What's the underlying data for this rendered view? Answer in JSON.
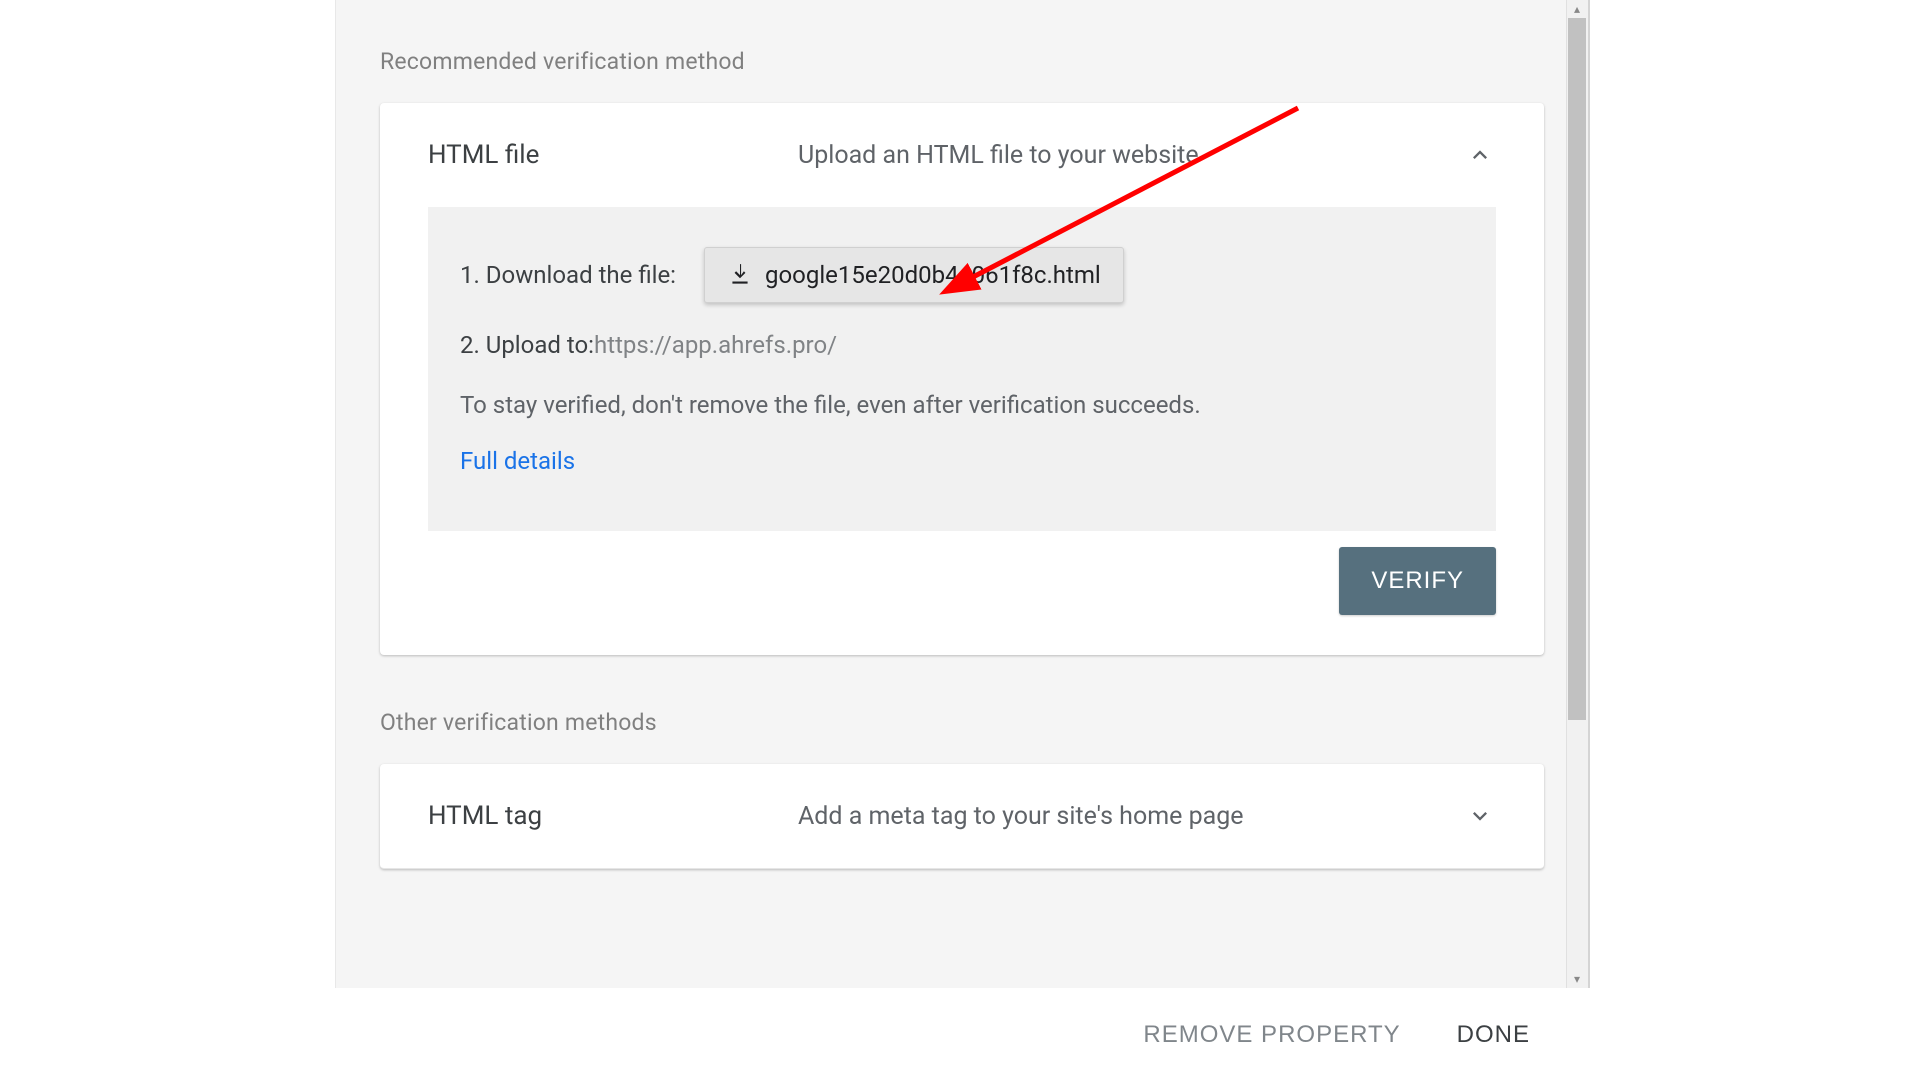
{
  "sections": {
    "recommended_label": "Recommended verification method",
    "other_label": "Other verification methods"
  },
  "htmlFileCard": {
    "title": "HTML file",
    "subtitle": "Upload an HTML file to your website",
    "step1_label": "1. Download the file:",
    "download_filename": "google15e20d0b4a061f8c.html",
    "step2_label": "2. Upload to: ",
    "upload_url": "https://app.ahrefs.pro/",
    "note": "To stay verified, don't remove the file, even after verification succeeds.",
    "details_link": "Full details",
    "verify_button": "VERIFY"
  },
  "htmlTagCard": {
    "title": "HTML tag",
    "subtitle": "Add a meta tag to your site's home page"
  },
  "footer": {
    "remove": "REMOVE PROPERTY",
    "done": "DONE"
  },
  "colors": {
    "accent": "#1a73e8",
    "verify_bg": "#56707e",
    "arrow": "#ff0000"
  }
}
